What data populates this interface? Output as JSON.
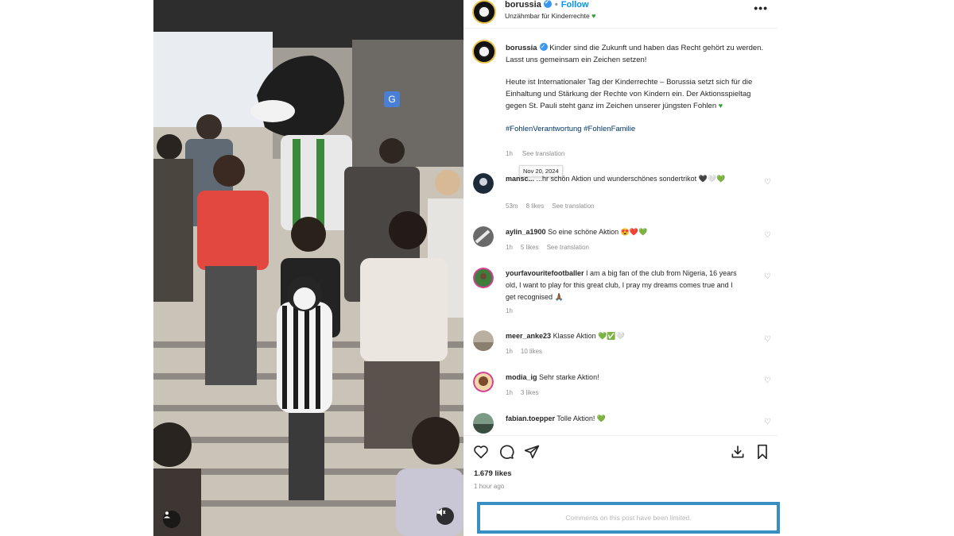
{
  "post": {
    "username": "borussia",
    "follow_label": "Follow",
    "separator": "•",
    "subtitle": "Unzähmbar für Kinderrechte",
    "more_label": "•••"
  },
  "caption": {
    "username": "borussia",
    "line1": "Kinder sind die Zukunft und haben das Recht gehört zu werden. Lasst uns gemeinsam ein Zeichen setzen!",
    "line2": "Heute ist Internationaler Tag der Kinderrechte – Borussia setzt sich für die Einhaltung und Stärkung der Rechte von Kindern ein. Der Aktionsspieltag gegen St. Pauli steht ganz im Zeichen unserer jüngsten Fohlen",
    "hashtags": "#FohlenVerantwortung #FohlenFamilie",
    "time": "1h",
    "see_translation": "See translation",
    "tooltip": "Nov 20, 2024"
  },
  "comments": [
    {
      "user": "mansc...",
      "text": "...hr schön Aktion und wunderschönes sondertrikot 🖤🤍💚",
      "time": "53m",
      "likes": "8 likes",
      "translation": "See translation"
    },
    {
      "user": "aylin_a1900",
      "text": "So eine schöne Aktion 😍❤️💚",
      "time": "1h",
      "likes": "5 likes",
      "translation": "See translation"
    },
    {
      "user": "yourfavouritefootballer",
      "text": "I am a big fan of the club from Nigeria, 16 years old, I want to play for this great club, I pray my dreams comes true and I get recognised 🙏🏾",
      "time": "1h",
      "likes": "",
      "translation": ""
    },
    {
      "user": "meer_anke23",
      "text": "Klasse Aktion 💚✅🤍",
      "time": "1h",
      "likes": "10 likes",
      "translation": ""
    },
    {
      "user": "modia_ig",
      "text": "Sehr starke Aktion!",
      "time": "1h",
      "likes": "3 likes",
      "translation": ""
    },
    {
      "user": "fabian.toepper",
      "text": "Tolle Aktion! 💚",
      "time": "",
      "likes": "",
      "translation": ""
    }
  ],
  "footer": {
    "likes": "1.679 likes",
    "time_ago": "1 hour ago",
    "limited": "Comments on this post have been limited."
  },
  "colors": {
    "accent": "#0095f6",
    "border_highlight": "#3a8fc2",
    "club_green": "#2e9e32"
  },
  "icons": [
    "heart-icon",
    "comment-icon",
    "share-icon",
    "download-icon",
    "bookmark-icon",
    "more-icon",
    "translate-icon",
    "person-tag-icon",
    "mute-icon"
  ]
}
